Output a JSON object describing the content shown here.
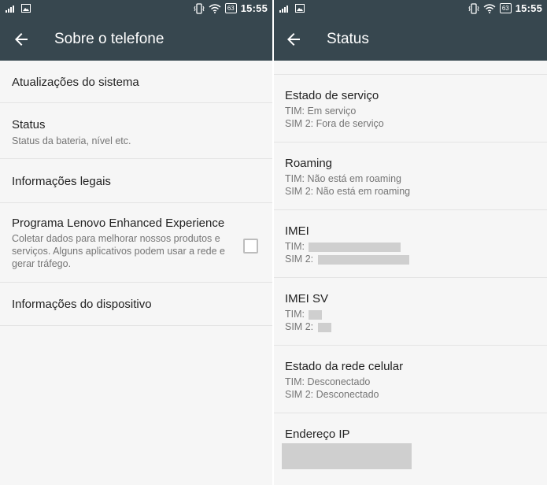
{
  "status_bar": {
    "time": "15:55",
    "battery": "63"
  },
  "left_screen": {
    "title": "Sobre o telefone",
    "items": [
      {
        "title": "Atualizações do sistema"
      },
      {
        "title": "Status",
        "subtitle": "Status da bateria, nível etc."
      },
      {
        "title": "Informações legais"
      },
      {
        "title": "Programa Lenovo Enhanced Experience",
        "subtitle": "Coletar dados para melhorar nossos produtos e serviços. Alguns aplicativos podem usar a rede e gerar tráfego.",
        "checked": false
      },
      {
        "title": "Informações do dispositivo"
      }
    ]
  },
  "right_screen": {
    "title": "Status",
    "items": [
      {
        "title": "Estado de serviço",
        "line1": "TIM: Em serviço",
        "line2": "SIM 2: Fora de serviço"
      },
      {
        "title": "Roaming",
        "line1": "TIM: Não está em roaming",
        "line2": "SIM 2: Não está em roaming"
      },
      {
        "title": "IMEI",
        "line1": "TIM:",
        "line2": "SIM 2:"
      },
      {
        "title": "IMEI SV",
        "line1": "TIM:",
        "line2": "SIM 2:"
      },
      {
        "title": "Estado da rede celular",
        "line1": "TIM: Desconectado",
        "line2": "SIM 2: Desconectado"
      },
      {
        "title": "Endereço IP"
      }
    ]
  }
}
